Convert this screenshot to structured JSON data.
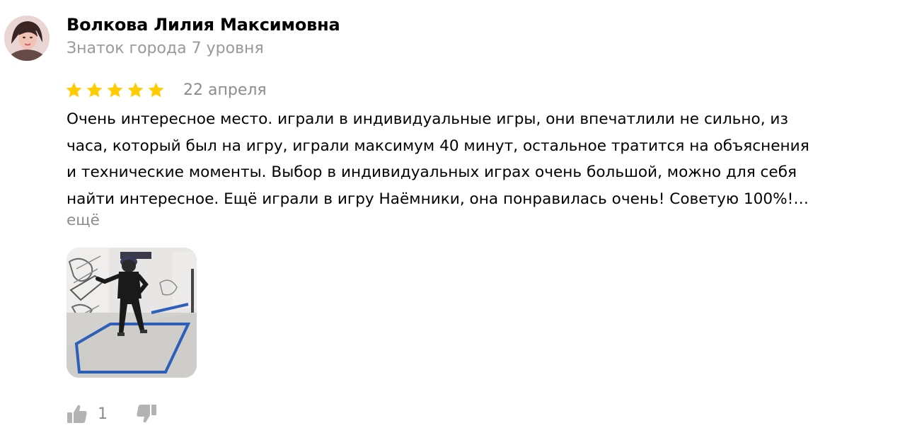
{
  "review": {
    "author": {
      "name": "Волкова Лилия Максимовна",
      "level": "Знаток города 7 уровня",
      "avatar_icon": "user-avatar-photo"
    },
    "rating": 5,
    "rating_max": 5,
    "date": "22 апреля",
    "text_lines": [
      "Очень интересное место. играли в индивидуальные игры, они впечатлили не сильно, из",
      "часа, который был на игру, играли максимум 40 минут, остальное тратится на объяснения",
      "и технические моменты. Выбор в индивидуальных играх очень большой, можно для себя",
      "найти интересное. Ещё играли в игру Наёмники, она понравилась очень! Советую 100%!…"
    ],
    "more_label": "ещё",
    "photo_icon": "review-photo-vr-player",
    "likes": "1",
    "like_icon": "thumbs-up-icon",
    "dislike_icon": "thumbs-down-icon"
  },
  "colors": {
    "star": "#fc0",
    "muted": "#999999",
    "text": "#000000",
    "icon": "#b3b3b3",
    "floor_tape": "#2b5fb8"
  }
}
